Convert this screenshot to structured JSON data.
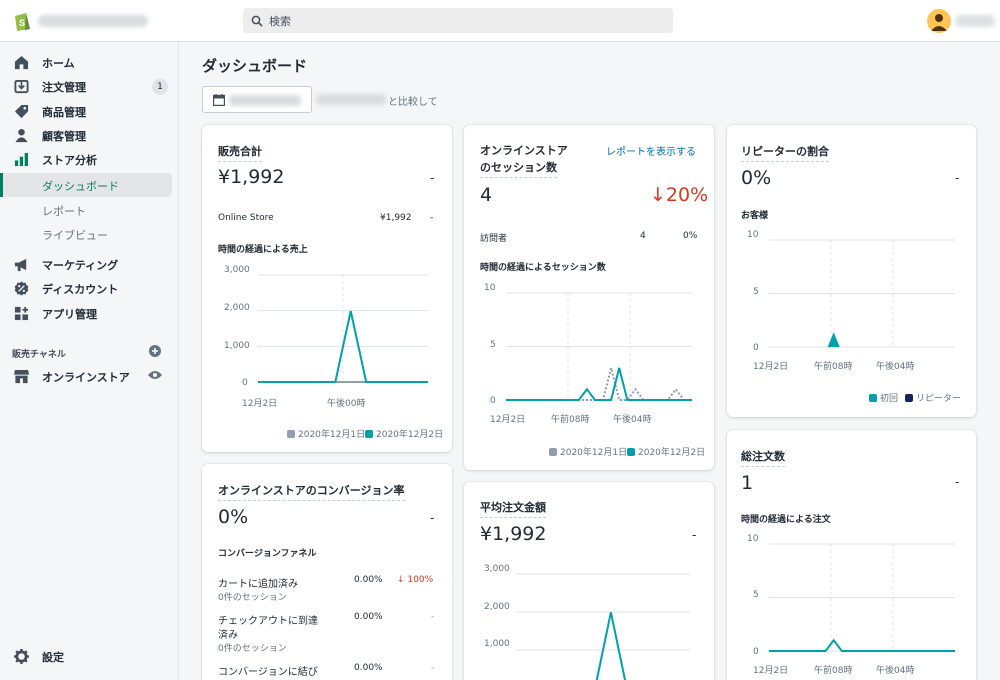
{
  "search": {
    "placeholder": "検索"
  },
  "sidebar": {
    "items": [
      {
        "label": "ホーム",
        "icon": "home-icon"
      },
      {
        "label": "注文管理",
        "icon": "orders-icon",
        "badge": "1"
      },
      {
        "label": "商品管理",
        "icon": "tag-icon"
      },
      {
        "label": "顧客管理",
        "icon": "person-icon"
      },
      {
        "label": "ストア分析",
        "icon": "analytics-icon"
      }
    ],
    "sub_items": [
      "ダッシュボード",
      "レポート",
      "ライブビュー"
    ],
    "items2": [
      {
        "label": "マーケティング",
        "icon": "megaphone-icon"
      },
      {
        "label": "ディスカウント",
        "icon": "discount-icon"
      },
      {
        "label": "アプリ管理",
        "icon": "apps-icon"
      }
    ],
    "channels_title": "販売チャネル",
    "channel": {
      "label": "オンラインストア",
      "icon": "store-icon"
    },
    "settings": "設定"
  },
  "page": {
    "title": "ダッシュボード",
    "compare_suffix": "と比較して"
  },
  "cards": {
    "sales": {
      "title": "販売合計",
      "value": "¥1,992",
      "change": "-",
      "row_label": "Online Store",
      "row_value": "¥1,992",
      "row_change": "-",
      "chart_title": "時間の経過による売上"
    },
    "sessions": {
      "title_line1": "オンラインストア",
      "title_line2": "のセッション数",
      "link": "レポートを表示する",
      "value": "4",
      "change": "↓20%",
      "row_label": "訪問者",
      "row_value": "4",
      "row_change": "0%",
      "chart_title": "時間の経過によるセッション数"
    },
    "returning": {
      "title": "リピーターの割合",
      "value": "0%",
      "change": "-",
      "chart_title": "お客様"
    },
    "conversion": {
      "title": "オンラインストアのコンバージョン率",
      "value": "0%",
      "change": "-",
      "funnel_title": "コンバージョンファネル",
      "rows": [
        {
          "label": "カートに追加済み",
          "sub": "0件のセッション",
          "value": "0.00%",
          "change": "↓ 100%"
        },
        {
          "label1": "チェックアウトに到達",
          "label2": "済み",
          "sub": "0件のセッション",
          "value": "0.00%",
          "change": "-"
        },
        {
          "label": "コンバージョンに結び",
          "value": "0.00%",
          "change": "-"
        }
      ]
    },
    "aov": {
      "title": "平均注文金額",
      "value": "¥1,992",
      "change": "-"
    },
    "orders": {
      "title": "総注文数",
      "value": "1",
      "change": "-",
      "chart_title": "時間の経過による注文"
    }
  },
  "chart_data": [
    {
      "type": "line",
      "card": "販売合計",
      "y_ticks": [
        "3,000",
        "2,000",
        "1,000",
        "0"
      ],
      "ylim": [
        0,
        3000
      ],
      "x_tick_labels": [
        "12月2日",
        "午後00時"
      ],
      "series": [
        {
          "name": "2020年12月1日",
          "color": "#919eab",
          "values": [
            0,
            0,
            0,
            0,
            0,
            0,
            0,
            0,
            0,
            0,
            0,
            0
          ]
        },
        {
          "name": "2020年12月2日",
          "color": "#00a0ac",
          "values": [
            0,
            0,
            0,
            0,
            0,
            0,
            1992,
            0,
            0,
            0,
            0,
            0
          ]
        }
      ]
    },
    {
      "type": "line",
      "card": "オンラインストアのセッション数",
      "y_ticks": [
        "10",
        "5",
        "0"
      ],
      "ylim": [
        0,
        10
      ],
      "x_tick_labels": [
        "12月2日",
        "午前08時",
        "午後04時"
      ],
      "series": [
        {
          "name": "2020年12月1日",
          "color": "#919eab",
          "dashed": true,
          "values": [
            0,
            0,
            0,
            0,
            0,
            0,
            0,
            0,
            0,
            0,
            0,
            0,
            0,
            3,
            0,
            0,
            1,
            0,
            0,
            0,
            0,
            1,
            0,
            0
          ]
        },
        {
          "name": "2020年12月2日",
          "color": "#00a0ac",
          "values": [
            0,
            0,
            0,
            0,
            0,
            0,
            0,
            0,
            0,
            0,
            1,
            0,
            0,
            0,
            3,
            0,
            0,
            0,
            0,
            0,
            0,
            0,
            0,
            0
          ]
        }
      ]
    },
    {
      "type": "scatter",
      "card": "リピーターの割合",
      "y_ticks": [
        "10",
        "5",
        "0"
      ],
      "ylim": [
        0,
        10
      ],
      "x_tick_labels": [
        "12月2日",
        "午前08時",
        "午後04時"
      ],
      "series": [
        {
          "name": "初回",
          "color": "#00a0ac",
          "points": [
            {
              "x": 8,
              "y": 1
            }
          ]
        },
        {
          "name": "リピーター",
          "color": "#1c2260",
          "points": []
        }
      ]
    },
    {
      "type": "line",
      "card": "平均注文金額",
      "y_ticks": [
        "3,000",
        "2,000",
        "1,000"
      ],
      "ylim": [
        0,
        3000
      ],
      "series": [
        {
          "name": "2020年12月2日",
          "color": "#00a0ac",
          "values": [
            0,
            0,
            0,
            0,
            0,
            0,
            1992,
            0,
            0,
            0,
            0,
            0
          ]
        }
      ]
    },
    {
      "type": "line",
      "card": "総注文数",
      "y_ticks": [
        "10",
        "5",
        "0"
      ],
      "ylim": [
        0,
        10
      ],
      "x_tick_labels": [
        "12月2日",
        "午前08時",
        "午後04時"
      ],
      "series": [
        {
          "name": "2020年12月2日",
          "color": "#00a0ac",
          "values": [
            0,
            0,
            0,
            0,
            0,
            0,
            0,
            0,
            1,
            0,
            0,
            0,
            0,
            0,
            0,
            0,
            0,
            0,
            0,
            0,
            0,
            0,
            0,
            0
          ]
        }
      ]
    }
  ]
}
